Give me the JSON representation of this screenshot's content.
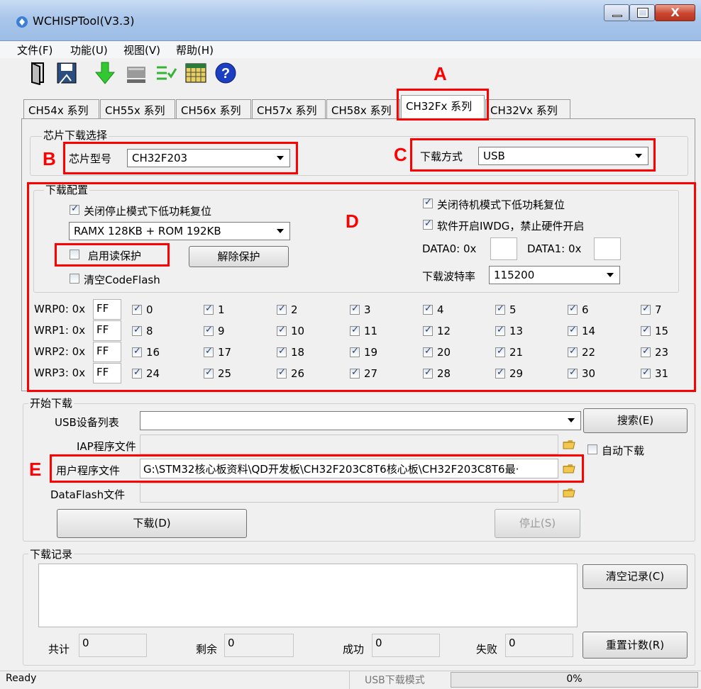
{
  "window": {
    "title": "WCHISPTool(V3.3)",
    "close_glyph": "X"
  },
  "menu": [
    "文件(F)",
    "功能(U)",
    "视图(V)",
    "帮助(H)"
  ],
  "toolbar": [
    "open-folder-icon",
    "save-icon",
    "download-arrow-icon",
    "device-icon",
    "list-check-icon",
    "calendar-grid-icon",
    "help-icon"
  ],
  "tabs": [
    "CH54x 系列",
    "CH55x 系列",
    "CH56x 系列",
    "CH57x 系列",
    "CH58x 系列",
    "CH32Fx 系列",
    "CH32Vx 系列"
  ],
  "markers": {
    "A": "A",
    "B": "B",
    "C": "C",
    "D": "D",
    "E": "E"
  },
  "chip_select": {
    "group_label": "芯片下载选择",
    "model_label": "芯片型号",
    "model_value": "CH32F203",
    "mode_label": "下载方式",
    "mode_value": "USB"
  },
  "download_config": {
    "group_label": "下载配置",
    "left": {
      "stop_lowpower_reset": "关闭停止模式下低功耗复位",
      "memory_value": "RAMX 128KB + ROM 192KB",
      "read_protect": "启用读保护",
      "unprotect_button": "解除保护",
      "clear_codeflash": "清空CodeFlash"
    },
    "right": {
      "standby_lowpower_reset": "关闭待机模式下低功耗复位",
      "iwdg": "软件开启IWDG，禁止硬件开启",
      "data0_label": "DATA0: 0x",
      "data0_value": "",
      "data1_label": "DATA1: 0x",
      "data1_value": "",
      "baud_label": "下载波特率",
      "baud_value": "115200"
    },
    "wrp": [
      {
        "label": "WRP0: 0x",
        "value": "FF",
        "bits": [
          "0",
          "1",
          "2",
          "3",
          "4",
          "5",
          "6",
          "7"
        ]
      },
      {
        "label": "WRP1: 0x",
        "value": "FF",
        "bits": [
          "8",
          "9",
          "10",
          "11",
          "12",
          "13",
          "14",
          "15"
        ]
      },
      {
        "label": "WRP2: 0x",
        "value": "FF",
        "bits": [
          "16",
          "17",
          "18",
          "19",
          "20",
          "21",
          "22",
          "23"
        ]
      },
      {
        "label": "WRP3: 0x",
        "value": "FF",
        "bits": [
          "24",
          "25",
          "26",
          "27",
          "28",
          "29",
          "30",
          "31"
        ]
      }
    ]
  },
  "start_download": {
    "group_label": "开始下载",
    "usb_list_label": "USB设备列表",
    "usb_list_value": "",
    "search_button": "搜索(E)",
    "iap_label": "IAP程序文件",
    "iap_value": "",
    "auto_download": "自动下载",
    "user_label": "用户程序文件",
    "user_value": "G:\\STM32核心板资料\\QD开发板\\CH32F203C8T6核心板\\CH32F203C8T6最·",
    "dataflash_label": "DataFlash文件",
    "dataflash_value": "",
    "download_button": "下载(D)",
    "stop_button": "停止(S)"
  },
  "log": {
    "group_label": "下载记录",
    "text": "",
    "clear_button": "清空记录(C)",
    "reset_button": "重置计数(R)",
    "total_label": "共计",
    "total_value": "0",
    "remaining_label": "剩余",
    "remaining_value": "0",
    "success_label": "成功",
    "success_value": "0",
    "fail_label": "失败",
    "fail_value": "0"
  },
  "status": {
    "ready": "Ready",
    "mode": "USB下载模式",
    "progress_text": "0%",
    "progress": 0
  }
}
